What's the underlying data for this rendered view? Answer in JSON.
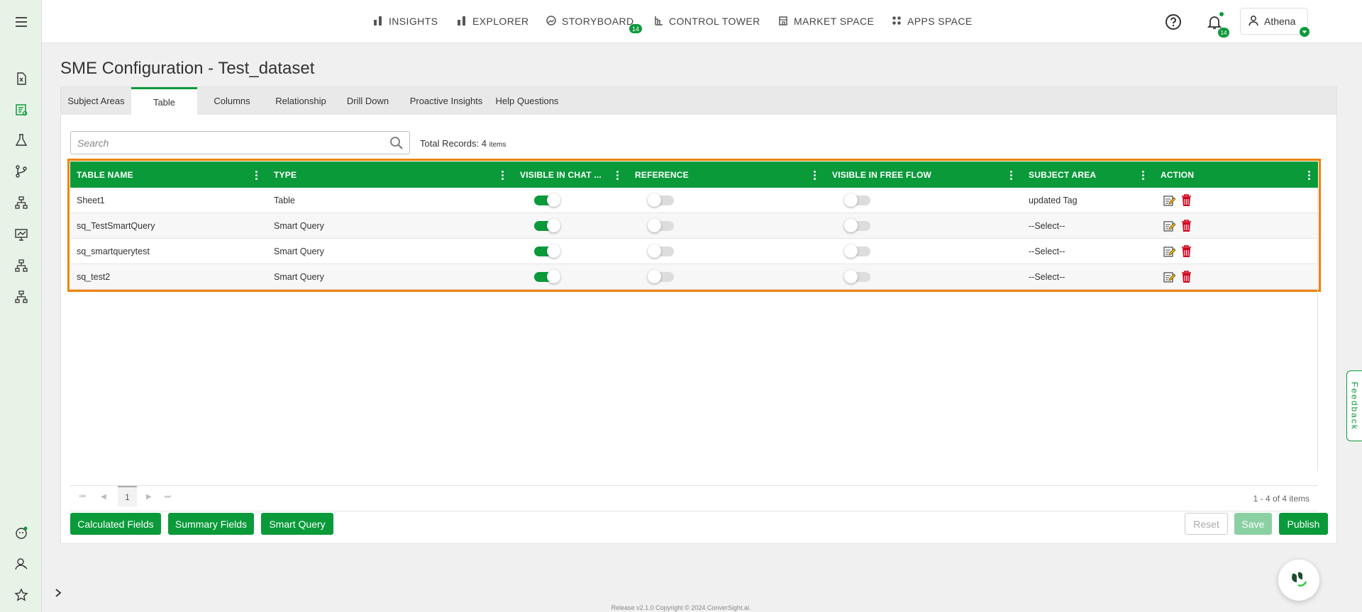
{
  "nav": {
    "items": [
      {
        "label": "INSIGHTS",
        "icon": "bar-chart-icon"
      },
      {
        "label": "EXPLORER",
        "icon": "bar-chart-icon"
      },
      {
        "label": "STORYBOARD",
        "icon": "storyboard-icon"
      },
      {
        "label": "CONTROL TOWER",
        "icon": "tower-icon"
      },
      {
        "label": "MARKET SPACE",
        "icon": "store-icon"
      },
      {
        "label": "APPS SPACE",
        "icon": "apps-grid-icon"
      }
    ],
    "storyboard_badge": "14",
    "notification_badge": "14",
    "user_name": "Athena"
  },
  "page": {
    "title": "SME Configuration - Test_dataset"
  },
  "tabs": [
    {
      "label": "Subject Areas",
      "active": false
    },
    {
      "label": "Table",
      "active": true
    },
    {
      "label": "Columns",
      "active": false
    },
    {
      "label": "Relationship",
      "active": false
    },
    {
      "label": "Drill Down",
      "active": false
    },
    {
      "label": "Proactive Insights",
      "active": false
    },
    {
      "label": "Help Questions",
      "active": false
    }
  ],
  "search": {
    "placeholder": "Search",
    "value": ""
  },
  "records": {
    "label": "Total Records:",
    "count": "4",
    "unit": "items"
  },
  "table": {
    "columns": [
      "TABLE NAME",
      "TYPE",
      "VISIBLE IN CHAT ...",
      "REFERENCE",
      "VISIBLE IN FREE FLOW",
      "SUBJECT AREA",
      "ACTION"
    ],
    "rows": [
      {
        "name": "Sheet1",
        "type": "Table",
        "visible_in_chat": true,
        "reference": false,
        "visible_in_free_flow": false,
        "subject_area": "updated Tag"
      },
      {
        "name": "sq_TestSmartQuery",
        "type": "Smart Query",
        "visible_in_chat": true,
        "reference": false,
        "visible_in_free_flow": false,
        "subject_area": "--Select--"
      },
      {
        "name": "sq_smartquerytest",
        "type": "Smart Query",
        "visible_in_chat": true,
        "reference": false,
        "visible_in_free_flow": false,
        "subject_area": "--Select--"
      },
      {
        "name": "sq_test2",
        "type": "Smart Query",
        "visible_in_chat": true,
        "reference": false,
        "visible_in_free_flow": false,
        "subject_area": "--Select--"
      }
    ]
  },
  "pager": {
    "page": "1",
    "info": "1 - 4 of 4 items"
  },
  "buttons": {
    "calculated_fields": "Calculated Fields",
    "summary_fields": "Summary Fields",
    "smart_query": "Smart Query",
    "reset": "Reset",
    "save": "Save",
    "publish": "Publish"
  },
  "feedback_label": "Feedback",
  "footer": "Release v2.1.0 Copyright © 2024 ConverSight.ai.",
  "colors": {
    "brand_green": "#0a9a3a",
    "highlight_orange": "#f08200"
  }
}
